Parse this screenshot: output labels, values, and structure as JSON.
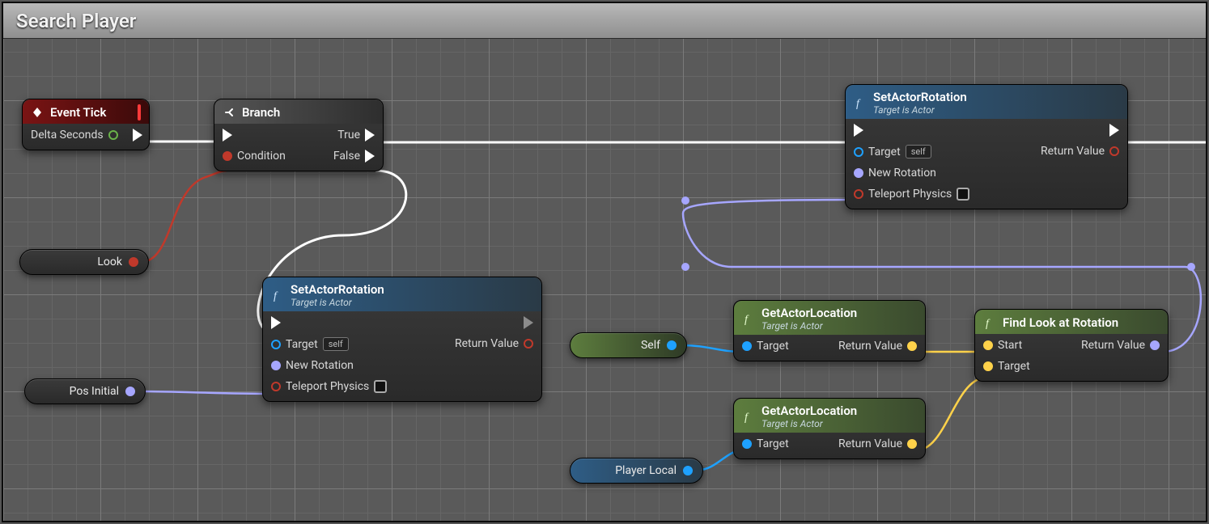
{
  "panel": {
    "title": "Search Player"
  },
  "common": {
    "target": "Target",
    "self": "self",
    "returnValue": "Return Value",
    "newRotation": "New Rotation",
    "teleportPhysics": "Teleport Physics",
    "targetIsActor": "Target is Actor"
  },
  "eventTick": {
    "title": "Event Tick",
    "deltaSeconds": "Delta Seconds"
  },
  "branch": {
    "title": "Branch",
    "condition": "Condition",
    "true": "True",
    "false": "False"
  },
  "setActorRotation": {
    "title": "SetActorRotation"
  },
  "getActorLocation": {
    "title": "GetActorLocation"
  },
  "findLookAt": {
    "title": "Find Look at Rotation",
    "start": "Start",
    "target": "Target"
  },
  "vars": {
    "look": "Look",
    "posInitial": "Pos Initial",
    "self": "Self",
    "playerLocal": "Player Local"
  }
}
